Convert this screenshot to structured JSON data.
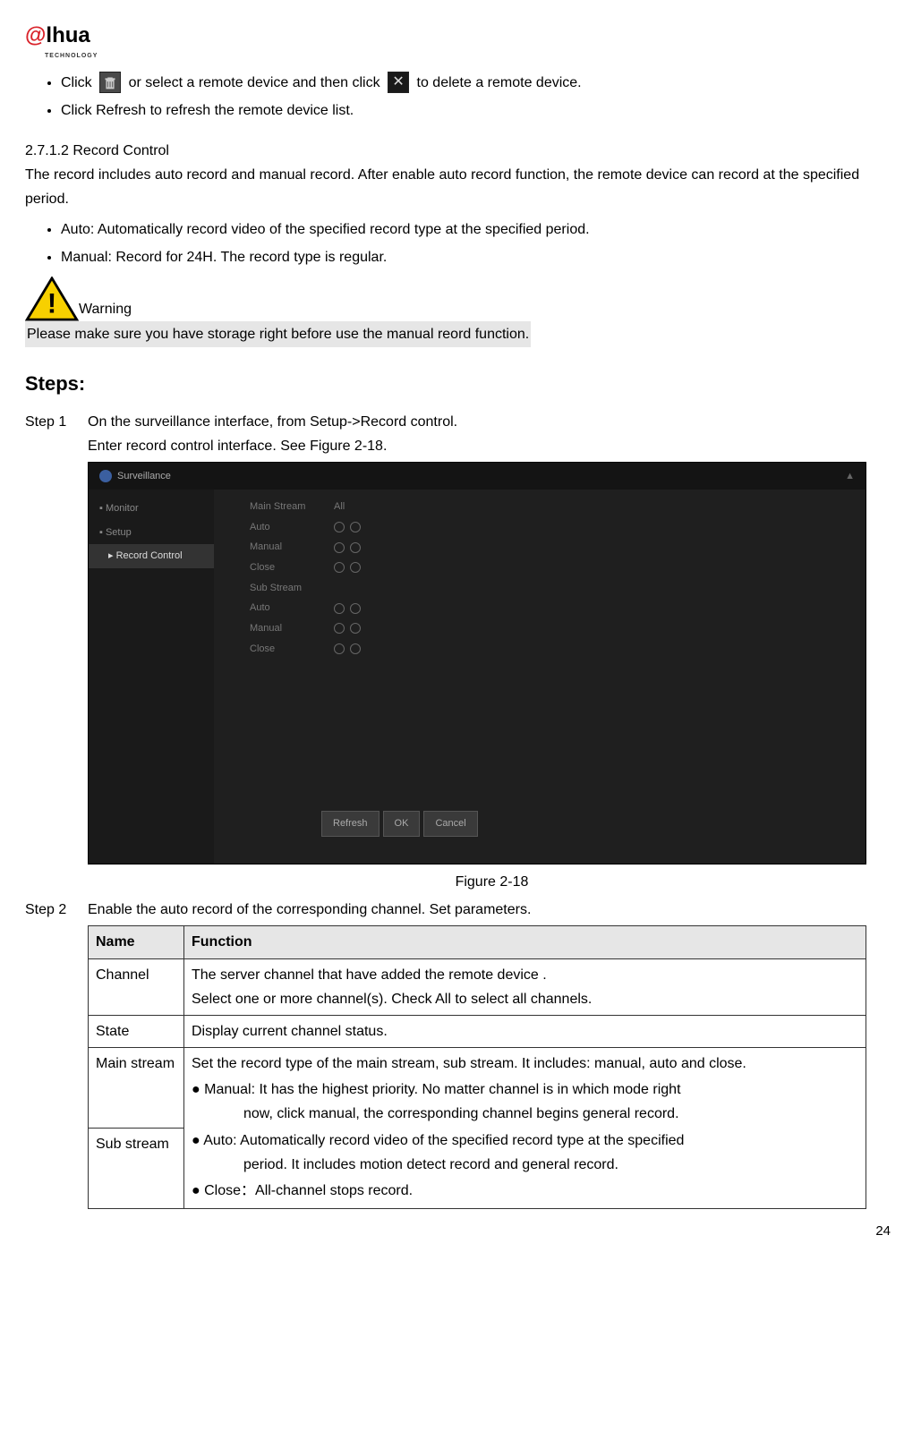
{
  "logo": {
    "prefix": "@",
    "rest": "lhua",
    "sub": "TECHNOLOGY"
  },
  "bullets_top": {
    "b1_pre": "Click ",
    "b1_mid": " or select a remote device and then click ",
    "b1_post": " to delete a remote device.",
    "b2": "Click Refresh to refresh the remote device list."
  },
  "section": {
    "num": "2.7.1.2 Record Control",
    "para": "The record includes auto record and manual record. After enable auto record function, the remote device can record at the specified period."
  },
  "bullets_rec": {
    "auto": "Auto: Automatically record video of the specified record type at the specified period.",
    "manual": "Manual: Record for 24H. The record type is regular."
  },
  "warning": {
    "label": "Warning",
    "text": "Please make sure you have storage right before use the manual reord function."
  },
  "steps_heading": "Steps:",
  "step1": {
    "label": "Step 1",
    "line1": "On the surveillance interface, from Setup->Record control.",
    "line2": "Enter record control interface. See Figure 2-18."
  },
  "screenshot": {
    "title": "Surveillance",
    "side": {
      "monitor": "Monitor",
      "setup": "Setup",
      "record_control": "Record Control"
    },
    "rows": {
      "main_stream": "Main Stream",
      "all": "All",
      "auto": "Auto",
      "manual": "Manual",
      "close": "Close",
      "sub_stream": "Sub Stream"
    },
    "buttons": {
      "refresh": "Refresh",
      "ok": "OK",
      "cancel": "Cancel"
    }
  },
  "figure_caption": "Figure 2-18",
  "step2": {
    "label": "Step 2",
    "text": "Enable the auto record of the corresponding channel. Set parameters."
  },
  "table": {
    "h_name": "Name",
    "h_func": "Function",
    "channel": {
      "name": "Channel",
      "l1": "The server channel that have added the remote device .",
      "l2": "Select one or more channel(s). Check All to select all channels."
    },
    "state": {
      "name": "State",
      "func": "Display current channel status."
    },
    "main": {
      "name": "Main stream"
    },
    "sub": {
      "name": "Sub stream"
    },
    "stream_func": {
      "intro": "Set the record type of the main stream, sub stream. It includes: manual, auto and close.",
      "manual1": "● Manual: It has the highest priority. No matter channel is in which mode right",
      "manual2": "now, click manual, the corresponding channel begins general record.",
      "auto1": "● Auto: Automatically record video of the specified record type at the specified",
      "auto2": "period. It includes motion detect record and general record.",
      "close": "● Close：All-channel stops record."
    }
  },
  "page_number": "24"
}
